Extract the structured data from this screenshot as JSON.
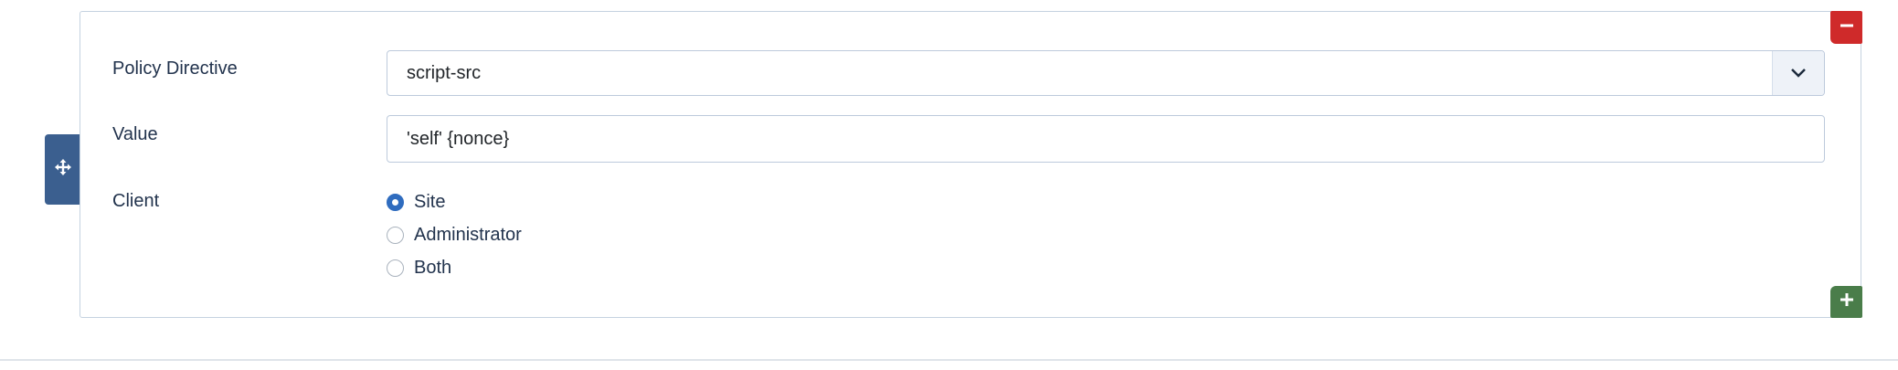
{
  "icons": {
    "drag": "move-icon",
    "remove": "minus-icon",
    "add": "plus-icon",
    "dropdown": "chevron-down-icon"
  },
  "colors": {
    "remove_button": "#cf2a2a",
    "add_button": "#4a7d4a",
    "drag_handle": "#3b5f8f",
    "radio_checked": "#2f6cbf"
  },
  "form": {
    "policy_directive": {
      "label": "Policy Directive",
      "selected": "script-src"
    },
    "value": {
      "label": "Value",
      "input_value": "'self' {nonce}"
    },
    "client": {
      "label": "Client",
      "options": [
        {
          "label": "Site",
          "checked": true
        },
        {
          "label": "Administrator",
          "checked": false
        },
        {
          "label": "Both",
          "checked": false
        }
      ]
    }
  }
}
